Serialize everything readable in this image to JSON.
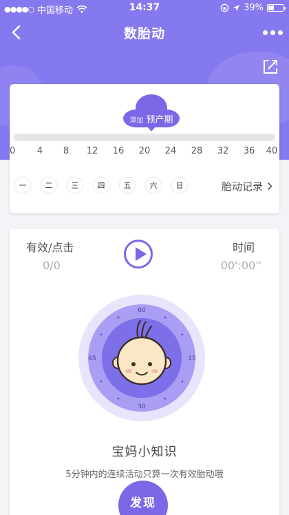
{
  "status": {
    "signal": "●●●●○",
    "carrier": "中国移动",
    "time": "14:37",
    "battery": "39%"
  },
  "nav": {
    "title": "数胎动"
  },
  "due_date": {
    "small": "添加",
    "big": "预产期"
  },
  "weeks": [
    "0",
    "4",
    "8",
    "12",
    "16",
    "20",
    "24",
    "28",
    "32",
    "36",
    "40"
  ],
  "weekdays": [
    "一",
    "二",
    "三",
    "四",
    "五",
    "六",
    "日"
  ],
  "record_label": "胎动记录",
  "counter": {
    "effective_label": "有效/点击",
    "effective_value": "0/0",
    "time_label": "时间",
    "time_value": "00':00''"
  },
  "dial": {
    "top": "60",
    "right": "15",
    "bottom": "30",
    "left": "45"
  },
  "knowledge": {
    "title": "宝妈小知识",
    "text": "5分钟内的连续活动只算一次有效胎动哦"
  },
  "discover_label": "发现",
  "colors": {
    "primary": "#8579ef",
    "accent": "#7a68e6",
    "dial_outer": "#e7e4fb",
    "dial_ring": "#a99ef3",
    "dial_inner": "#7d6fe8",
    "face": "#fbe7c6"
  }
}
